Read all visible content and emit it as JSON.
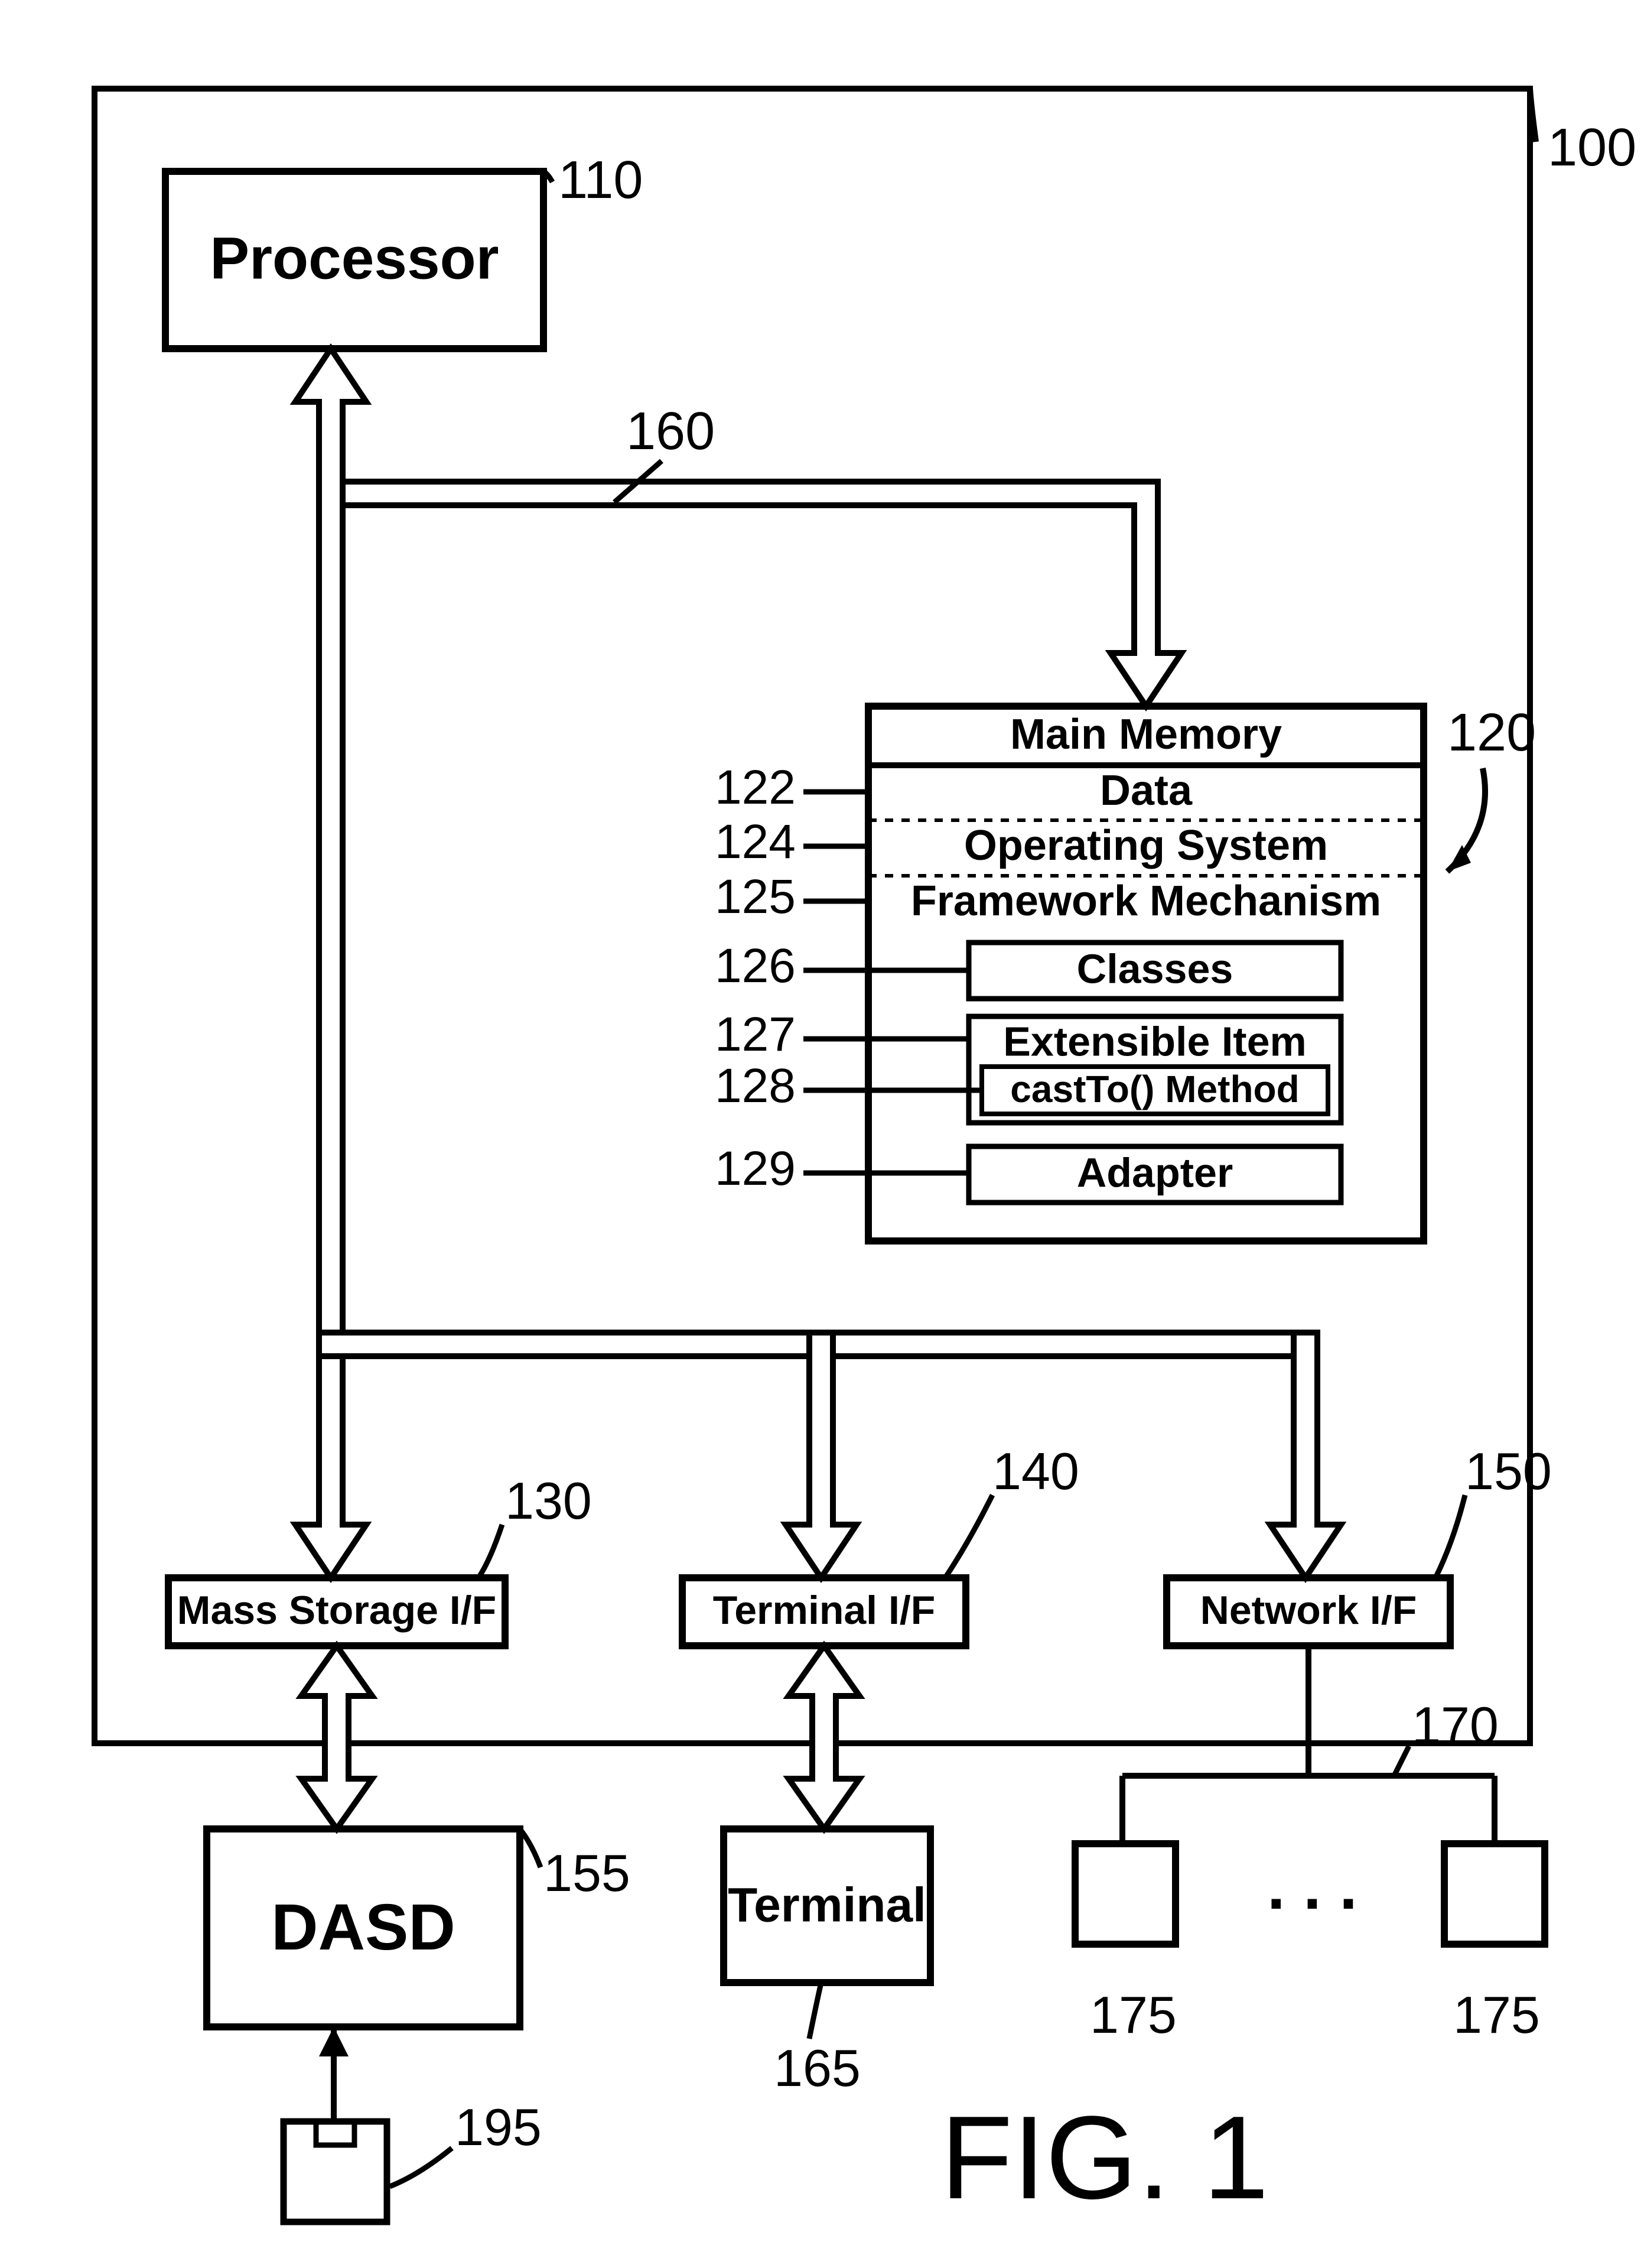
{
  "figure_label": "FIG. 1",
  "outer_ref": "100",
  "processor": {
    "label": "Processor",
    "ref": "110"
  },
  "bus_ref": "160",
  "memory": {
    "title": "Main Memory",
    "ref": "120",
    "rows": {
      "data": {
        "label": "Data",
        "ref": "122"
      },
      "os": {
        "label": "Operating System",
        "ref": "124"
      },
      "fw": {
        "label": "Framework Mechanism",
        "ref": "125"
      },
      "classes": {
        "label": "Classes",
        "ref": "126"
      },
      "ext": {
        "label": "Extensible Item",
        "ref": "127"
      },
      "cast": {
        "label": "castTo() Method",
        "ref": "128"
      },
      "adapter": {
        "label": "Adapter",
        "ref": "129"
      }
    }
  },
  "mass_if": {
    "label": "Mass Storage I/F",
    "ref": "130"
  },
  "term_if": {
    "label": "Terminal I/F",
    "ref": "140"
  },
  "net_if": {
    "label": "Network I/F",
    "ref": "150"
  },
  "dasd": {
    "label": "DASD",
    "ref": "155"
  },
  "terminal": {
    "label": "Terminal",
    "ref": "165"
  },
  "net_line_ref": "170",
  "node_a_ref": "175",
  "node_b_ref": "175",
  "floppy_ref": "195",
  "dots": ". . ."
}
